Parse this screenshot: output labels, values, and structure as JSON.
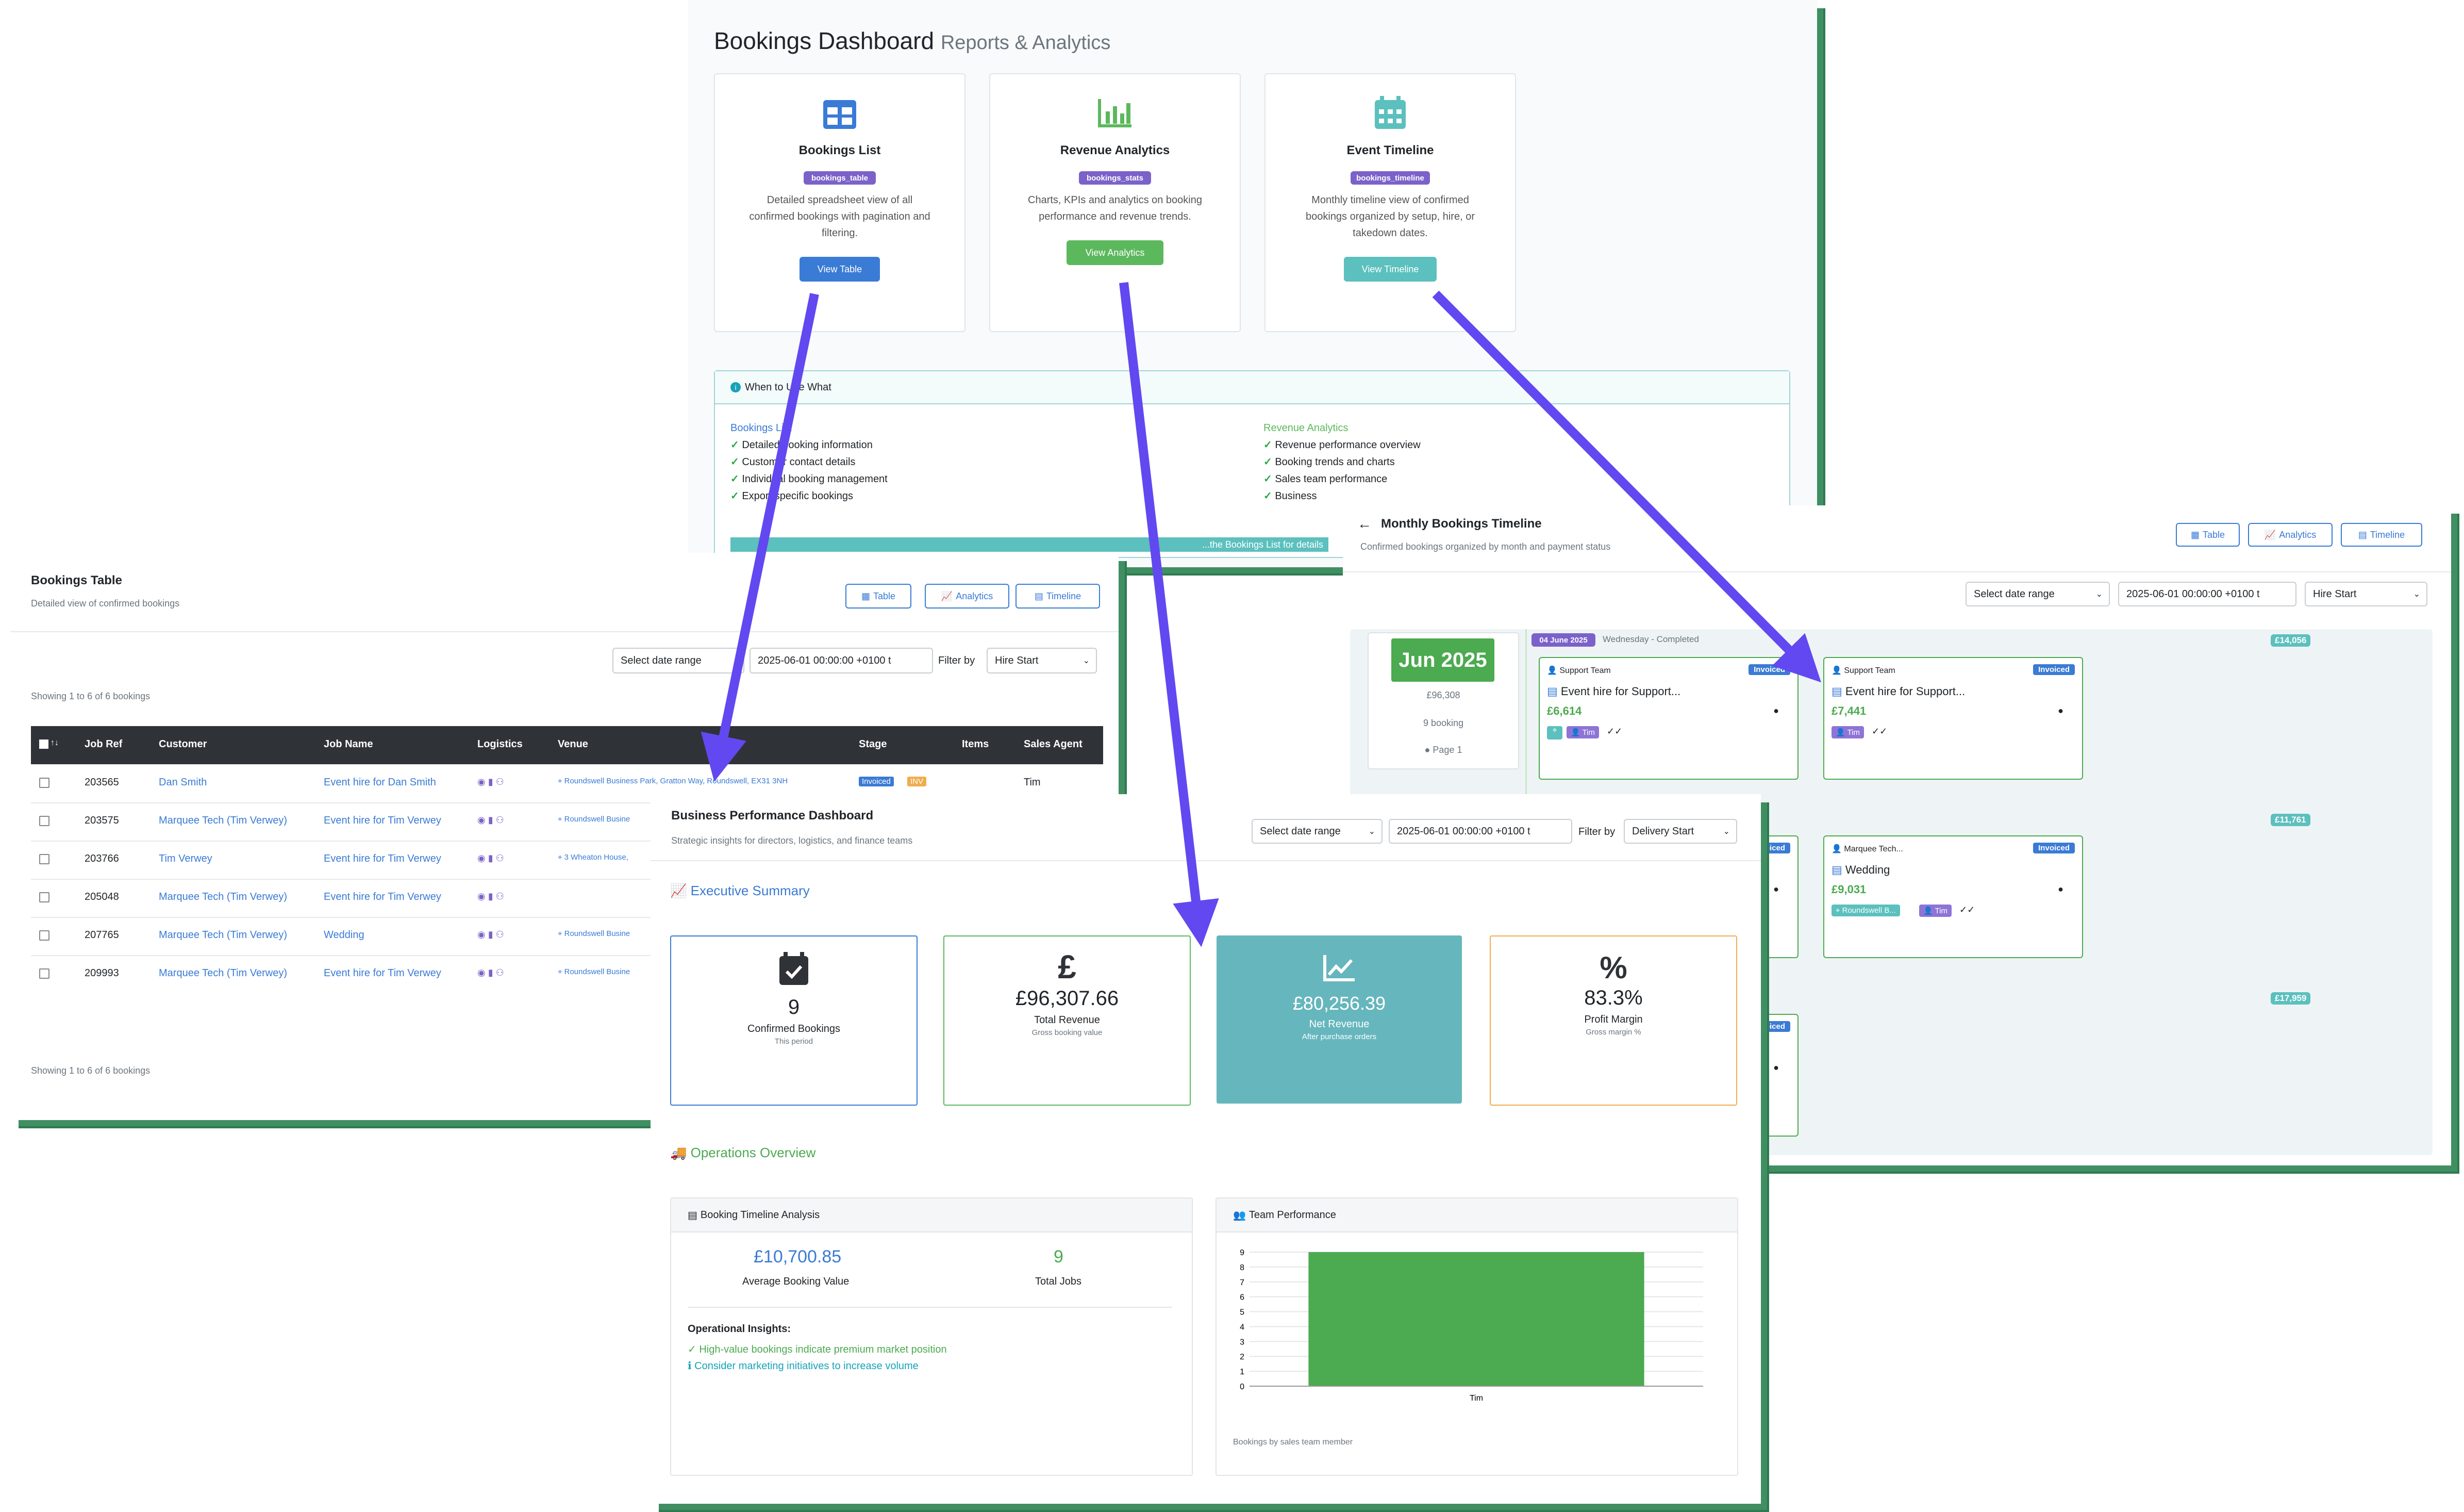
{
  "dashboard": {
    "title": "Bookings Dashboard",
    "subtitle": "Reports & Analytics",
    "cards": [
      {
        "title": "Bookings List",
        "tag": "bookings_table",
        "desc": [
          "Detailed spreadsheet view of all",
          "confirmed bookings with pagination and",
          "filtering."
        ],
        "button": "View Table",
        "icon": "table-icon",
        "color": "#3a7bd5"
      },
      {
        "title": "Revenue Analytics",
        "tag": "bookings_stats",
        "desc": [
          "Charts, KPIs and analytics on booking",
          "performance and revenue trends."
        ],
        "button": "View Analytics",
        "icon": "bar-chart-icon",
        "color": "#5cb85c"
      },
      {
        "title": "Event Timeline",
        "tag": "bookings_timeline",
        "desc": [
          "Monthly timeline view of confirmed",
          "bookings organized by setup, hire, or",
          "takedown dates."
        ],
        "button": "View Timeline",
        "icon": "calendar-icon",
        "color": "#5bc0be"
      }
    ],
    "when_to_use": {
      "title": "When to Use What",
      "left_title": "Bookings List",
      "left_items": [
        "Detailed booking information",
        "Customer contact details",
        "Individual booking management",
        "Export specific bookings"
      ],
      "right_title": "Revenue Analytics",
      "right_items": [
        "Revenue performance overview",
        "Booking trends and charts",
        "Sales team performance",
        "Business "
      ],
      "footer": "...the Bookings List for details"
    }
  },
  "table_view": {
    "title": "Bookings Table",
    "subtitle": "Detailed view of confirmed bookings",
    "buttons": [
      "Table",
      "Analytics",
      "Timeline"
    ],
    "date_placeholder": "Select date range",
    "date_value": "2025-06-01 00:00:00 +0100 t",
    "filter_label": "Filter by",
    "filter_value": "Hire Start",
    "showing": "Showing 1 to 6 of 6 bookings",
    "columns": [
      "Job Ref",
      "Customer",
      "Job Name",
      "Logistics",
      "Venue",
      "Stage",
      "Items",
      "Sales Agent"
    ],
    "rows": [
      {
        "ref": "203565",
        "customer": "Dan Smith",
        "job": "Event hire for Dan Smith",
        "venue": "Roundswell Business Park, Gratton Way, Roundswell, EX31 3NH",
        "stage": "Invoiced",
        "items": "INV",
        "agent": "Tim"
      },
      {
        "ref": "203575",
        "customer": "Marquee Tech (Tim Verwey)",
        "job": "Event hire for Tim Verwey",
        "venue": "Roundswell Busine",
        "stage": "",
        "items": "",
        "agent": ""
      },
      {
        "ref": "203766",
        "customer": "Tim Verwey",
        "job": "Event hire for Tim Verwey",
        "venue": "3 Wheaton House,",
        "stage": "",
        "items": "",
        "agent": ""
      },
      {
        "ref": "205048",
        "customer": "Marquee Tech (Tim Verwey)",
        "job": "Event hire for Tim Verwey",
        "venue": "",
        "stage": "",
        "items": "",
        "agent": ""
      },
      {
        "ref": "207765",
        "customer": "Marquee Tech (Tim Verwey)",
        "job": "Wedding",
        "venue": "Roundswell Busine",
        "stage": "",
        "items": "",
        "agent": ""
      },
      {
        "ref": "209993",
        "customer": "Marquee Tech (Tim Verwey)",
        "job": "Event hire for Tim Verwey",
        "venue": "Roundswell Busine",
        "stage": "",
        "items": "",
        "agent": ""
      }
    ]
  },
  "timeline_view": {
    "title": "Monthly Bookings Timeline",
    "subtitle": "Confirmed bookings organized by month and payment status",
    "buttons": [
      "Table",
      "Analytics",
      "Timeline"
    ],
    "date_placeholder": "Select date range",
    "date_value": "2025-06-01 00:00:00 +0100 t",
    "filter_value": "Hire Start",
    "month": {
      "label": "Jun 2025",
      "total": "£96,308",
      "count": "9 booking",
      "page": "Page 1"
    },
    "day_label": "04 June 2025",
    "day_desc": "Wednesday - Completed",
    "day_totals": [
      "£14,056",
      "£11,761",
      "£17,959"
    ],
    "bookings": [
      {
        "team": "Support Team",
        "status": "Invoiced",
        "name": "Event hire for Support...",
        "amount": "£6,614",
        "agent": "Tim"
      },
      {
        "team": "Support Team",
        "status": "Invoiced",
        "name": "Event hire for Support...",
        "amount": "£7,441",
        "agent": "Tim"
      },
      {
        "team": "Marquee Tech...",
        "status": "Invoiced",
        "name": "Wedding",
        "amount": "£9,031",
        "agent": "Tim",
        "venue": "Roundswell B..."
      }
    ]
  },
  "performance": {
    "title": "Business Performance Dashboard",
    "subtitle": "Strategic insights for directors, logistics, and finance teams",
    "date_placeholder": "Select date range",
    "date_value": "2025-06-01 00:00:00 +0100 t",
    "filter_label": "Filter by",
    "filter_value": "Delivery Start",
    "exec_title": "Executive Summary",
    "kpis": [
      {
        "value": "9",
        "label": "Confirmed Bookings",
        "sub": "This period",
        "icon": "calendar-check-icon",
        "border": "#3a7bd5"
      },
      {
        "value": "£96,307.66",
        "label": "Total Revenue",
        "sub": "Gross booking value",
        "icon": "pound-icon",
        "border": "#5cb85c"
      },
      {
        "value": "£80,256.39",
        "label": "Net Revenue",
        "sub": "After purchase orders",
        "icon": "trend-icon",
        "border": "#66b6bd"
      },
      {
        "value": "83.3%",
        "label": "Profit Margin",
        "sub": "Gross margin %",
        "icon": "percent-icon",
        "border": "#f0ad4e"
      }
    ],
    "ops_title": "Operations Overview",
    "timeline_title": "Booking Timeline Analysis",
    "avg_value": "£10,700.85",
    "avg_label": "Average Booking Value",
    "total_jobs": "9",
    "total_jobs_label": "Total Jobs",
    "insights_title": "Operational Insights:",
    "insights": [
      "High-value bookings indicate premium market position",
      "Consider marketing initiatives to increase volume"
    ],
    "team_title": "Team Performance",
    "chart_caption": "Bookings by sales team member"
  },
  "chart_data": {
    "type": "bar",
    "categories": [
      "Tim"
    ],
    "values": [
      9
    ],
    "ylim": [
      0,
      9
    ],
    "yticks": [
      "0",
      "1",
      "2",
      "3",
      "4",
      "5",
      "6",
      "7",
      "8",
      "9"
    ],
    "color": "#4caa50",
    "grid": true
  }
}
